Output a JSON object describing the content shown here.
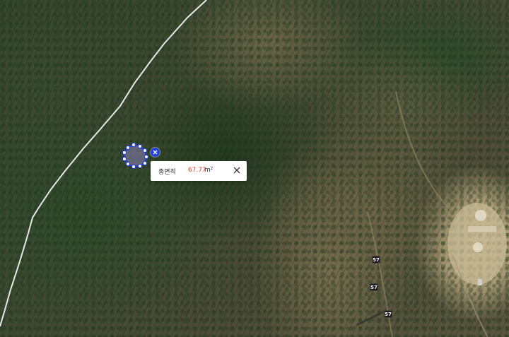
{
  "map": {
    "type": "satellite",
    "colors": {
      "measure_stroke": "#2540d8",
      "measure_fill": "#8a7db8",
      "vertex_fill": "#ffffff",
      "value_text": "#e43a2f",
      "road_line": "#e8e8e8"
    }
  },
  "measurement": {
    "label": "총면적",
    "value": "67.77",
    "unit": "m²",
    "close_icon": "close-icon",
    "clear_icon": "clear-x-icon"
  },
  "road_labels": [
    {
      "text": "57"
    },
    {
      "text": "57"
    },
    {
      "text": "57"
    }
  ]
}
